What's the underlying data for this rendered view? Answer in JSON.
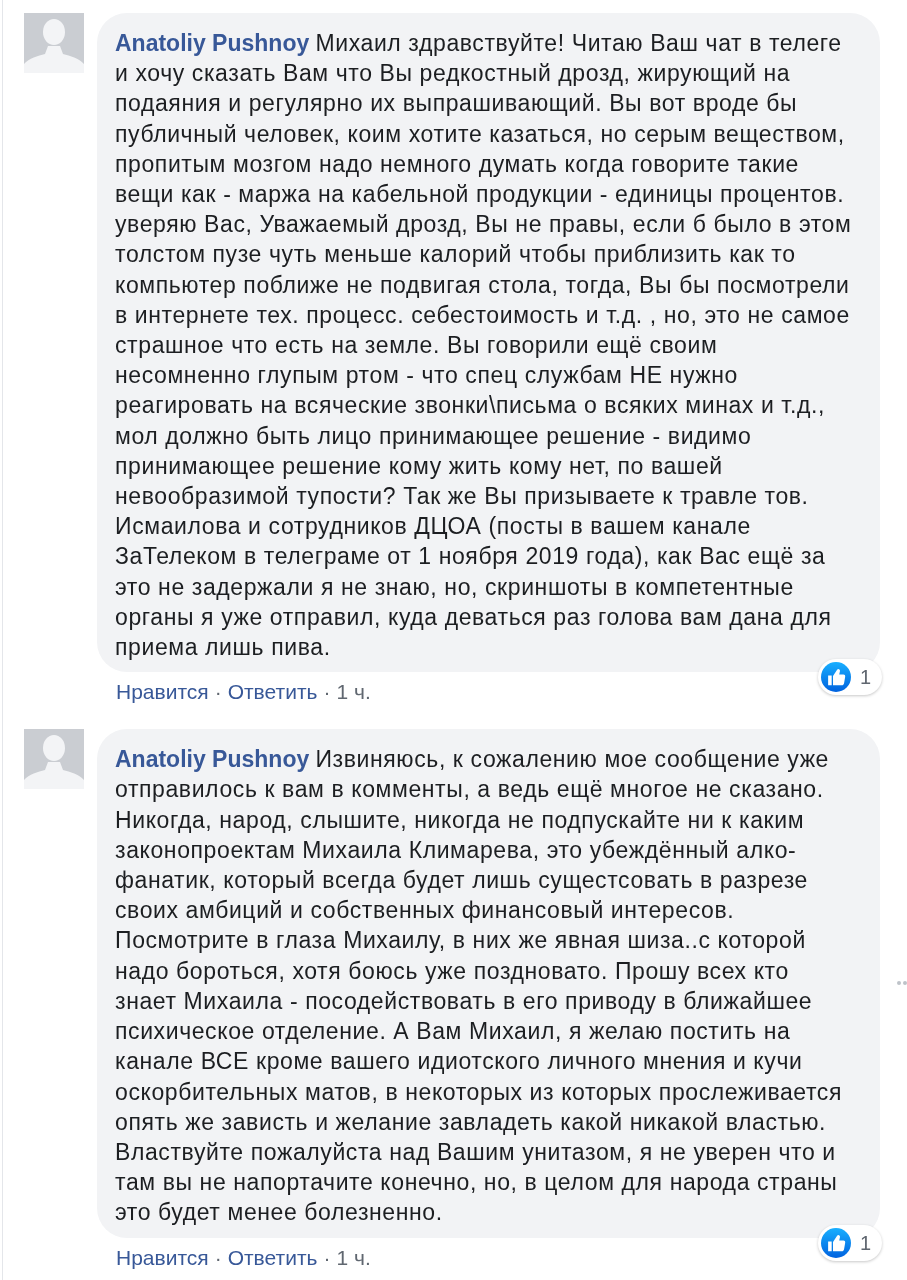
{
  "comments": [
    {
      "author": "Anatoliy Pushnoy",
      "text": "Михаил здравствуйте! Читаю Ваш чат в телеге и хочу сказать Вам что Вы редкостный дрозд, жирующий на подаяния и регулярно их выпрашивающий. Вы вот вроде бы публичный человек, коим хотите казаться, но серым веществом, пропитым мозгом надо немного думать когда говорите такие вещи как - маржа на кабельной продукции - единицы процентов. уверяю Вас, Уважаемый дрозд, Вы не правы, если б было в этом толстом пузе чуть меньше калорий чтобы приблизить как то компьютер поближе не подвигая стола, тогда, Вы бы посмотрели в интернете тех. процесс. себестоимость и т.д. , но, это не самое страшное что есть на земле. Вы говорили ещё своим несомненно глупым ртом - что спец службам НЕ нужно реагировать на всяческие звонки\\письма о всяких минах и т.д., мол должно быть лицо принимающее решение - видимо принимающее решение кому жить кому нет, по вашей невообразимой тупости? Так же Вы призываете к травле тов. Исмаилова и сотрудников ДЦОА (посты в вашем канале ЗаТелеком в телеграме от 1 ноября 2019 года), как Вас ещё за это не задержали я не знаю, но, скриншоты в компетентные органы я уже отправил, куда деваться раз голова вам дана для приема лишь пива.",
      "reactions_count": "1",
      "options_visible": false,
      "actions": [
        {
          "kind": "like",
          "text": "Нравится"
        },
        {
          "kind": "separator",
          "text": "·"
        },
        {
          "kind": "reply",
          "text": "Ответить"
        },
        {
          "kind": "separator",
          "text": "·"
        },
        {
          "kind": "time",
          "text": "1 ч."
        }
      ]
    },
    {
      "author": "Anatoliy Pushnoy",
      "text": "Извиняюсь, к сожалению мое сообщение уже отправилось к вам в комменты, а ведь ещё многое не сказано. Никогда, народ, слышите, никогда не подпускайте ни к каким законопроектам Михаила Климарева, это убеждённый алко-фанатик, который всегда будет лишь сущестсовать в разрезе своих амбиций и собственных финансовый интересов. Посмотрите в глаза Михаилу, в них же явная шиза..с которой надо бороться, хотя боюсь уже поздновато. Прошу всех кто знает Михаила - посодействовать в его приводу в ближайшее психическое отделение. А Вам Михаил, я желаю постить на канале ВСЕ кроме вашего идиотского личного мнения и кучи оскорбительных матов, в некоторых из которых прослеживается опять же зависть и желание завладеть какой никакой властью. Властвуйте пожалуйста над Вашим унитазом, я не уверен что и там вы не напортачите конечно, но, в целом для народа страны это будет менее болезненно.",
      "reactions_count": "1",
      "options_visible": true,
      "actions": [
        {
          "kind": "like",
          "text": "Нравится"
        },
        {
          "kind": "separator",
          "text": "·"
        },
        {
          "kind": "reply",
          "text": "Ответить"
        },
        {
          "kind": "separator",
          "text": "·"
        },
        {
          "kind": "time",
          "text": "1 ч."
        }
      ]
    }
  ]
}
